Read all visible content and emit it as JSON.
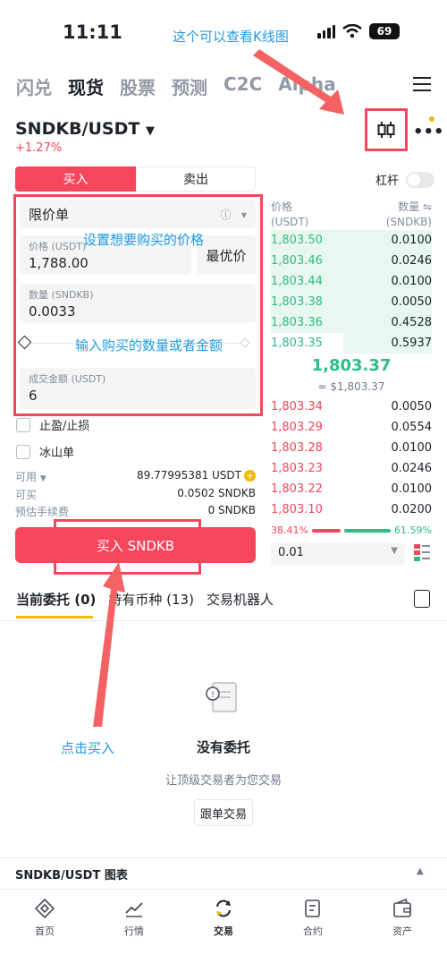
{
  "status": {
    "time": "11:11",
    "battery": "69"
  },
  "annotations": {
    "kline_note": "这个可以查看K线图",
    "price_note": "设置想要购买的价格",
    "qty_note": "输入购买的数量或者金额",
    "buy_note": "点击买入"
  },
  "top_tabs": [
    "闪兑",
    "现货",
    "股票",
    "预测",
    "C2C",
    "Alpha"
  ],
  "pair": {
    "symbol": "SNDKB/USDT",
    "change": "+1.27%"
  },
  "trade_tabs": {
    "buy": "买入",
    "sell": "卖出",
    "leverage": "杠杆"
  },
  "form": {
    "order_type": "限价单",
    "price_label": "价格 (USDT)",
    "price_value": "1,788.00",
    "best_price": "最优价",
    "qty_label": "数量 (SNDKB)",
    "qty_value": "0.0033",
    "total_label": "成交金额 (USDT)",
    "total_value": "6",
    "tp_sl": "止盈/止损",
    "iceberg": "冰山单"
  },
  "balances": [
    {
      "label": "可用",
      "value": "89.77995381 USDT"
    },
    {
      "label": "可买",
      "value": "0.0502 SNDKB"
    },
    {
      "label": "预估手续费",
      "value": "0 SNDKB"
    }
  ],
  "buy_button": "买入 SNDKB",
  "orderbook": {
    "price_header": "价格",
    "price_unit": "(USDT)",
    "qty_header": "数量",
    "qty_unit": "(SNDKB)",
    "bids_top": [
      {
        "price": "1,803.50",
        "qty": "0.0100",
        "depth": 1.0
      },
      {
        "price": "1,803.46",
        "qty": "0.0246",
        "depth": 1.0
      },
      {
        "price": "1,803.44",
        "qty": "0.0100",
        "depth": 1.0
      },
      {
        "price": "1,803.38",
        "qty": "0.0050",
        "depth": 1.0
      },
      {
        "price": "1,803.36",
        "qty": "0.4528",
        "depth": 1.0
      },
      {
        "price": "1,803.35",
        "qty": "0.5937",
        "depth": 0.55
      }
    ],
    "last_price": "1,803.37",
    "last_usd": "≈ $1,803.37",
    "asks": [
      {
        "price": "1,803.34",
        "qty": "0.0050"
      },
      {
        "price": "1,803.29",
        "qty": "0.0554"
      },
      {
        "price": "1,803.28",
        "qty": "0.0100"
      },
      {
        "price": "1,803.23",
        "qty": "0.0246"
      },
      {
        "price": "1,803.22",
        "qty": "0.0100"
      },
      {
        "price": "1,803.10",
        "qty": "0.0200"
      }
    ],
    "buy_ratio": "38.41%",
    "sell_ratio": "61.59%",
    "depth": "0.01"
  },
  "order_tabs": [
    "当前委托 (0)",
    "持有币种 (13)",
    "交易机器人"
  ],
  "empty": {
    "title": "没有委托",
    "subtitle": "让顶级交易者为您交易",
    "button": "跟单交易"
  },
  "chart_bar_label": "SNDKB/USDT 图表",
  "bottom_nav": [
    "首页",
    "行情",
    "交易",
    "合约",
    "资产"
  ]
}
